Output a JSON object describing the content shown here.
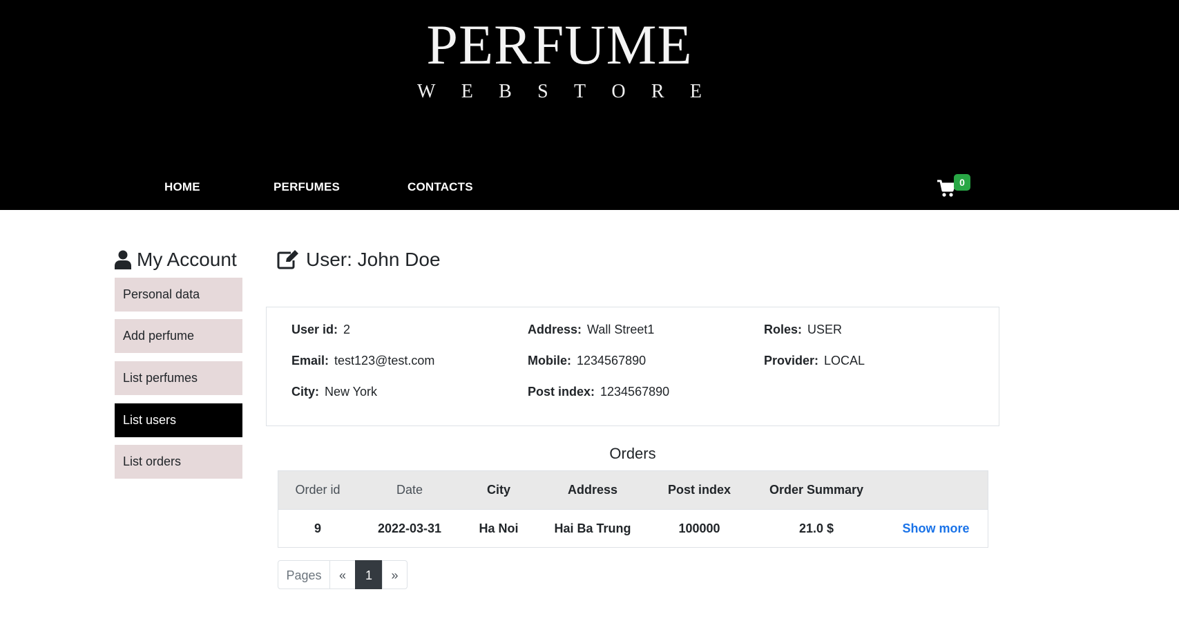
{
  "logo": {
    "title": "PERFUME",
    "subtitle": [
      "W",
      "E",
      "B",
      "S",
      "T",
      "O",
      "R",
      "E"
    ]
  },
  "nav": {
    "home": "HOME",
    "perfumes": "PERFUMES",
    "contacts": "CONTACTS"
  },
  "cart": {
    "icon": "shopping-cart-icon",
    "count": "0",
    "badge_color": "#28a745"
  },
  "sidebar": {
    "title": "My Account",
    "icon": "user-icon",
    "items": [
      {
        "label": "Personal data",
        "active": false
      },
      {
        "label": "Add perfume",
        "active": false
      },
      {
        "label": "List perfumes",
        "active": false
      },
      {
        "label": "List users",
        "active": true
      },
      {
        "label": "List orders",
        "active": false
      }
    ]
  },
  "user": {
    "title": "User: John Doe",
    "icon": "edit-icon",
    "fields": {
      "user_id": {
        "label": "User id:",
        "value": "2"
      },
      "email": {
        "label": "Email:",
        "value": "test123@test.com"
      },
      "city": {
        "label": "City:",
        "value": "New York"
      },
      "address": {
        "label": "Address:",
        "value": "Wall Street1"
      },
      "mobile": {
        "label": "Mobile:",
        "value": "1234567890"
      },
      "post_index": {
        "label": "Post index:",
        "value": "1234567890"
      },
      "roles": {
        "label": "Roles:",
        "value": "USER"
      },
      "provider": {
        "label": "Provider:",
        "value": "LOCAL"
      }
    }
  },
  "orders": {
    "title": "Orders",
    "columns": [
      "Order id",
      "Date",
      "City",
      "Address",
      "Post index",
      "Order Summary",
      ""
    ],
    "rows": [
      {
        "id": "9",
        "date": "2022-03-31",
        "city": "Ha Noi",
        "address": "Hai Ba Trung",
        "post_index": "100000",
        "summary": "21.0 $",
        "action": "Show more"
      }
    ]
  },
  "pagination": {
    "label": "Pages",
    "prev": "«",
    "current": "1",
    "next": "»"
  },
  "colors": {
    "header_bg": "#000000",
    "sidebar_item_bg": "#e6d9da",
    "sidebar_active_bg": "#000000",
    "link": "#1a73e8"
  }
}
